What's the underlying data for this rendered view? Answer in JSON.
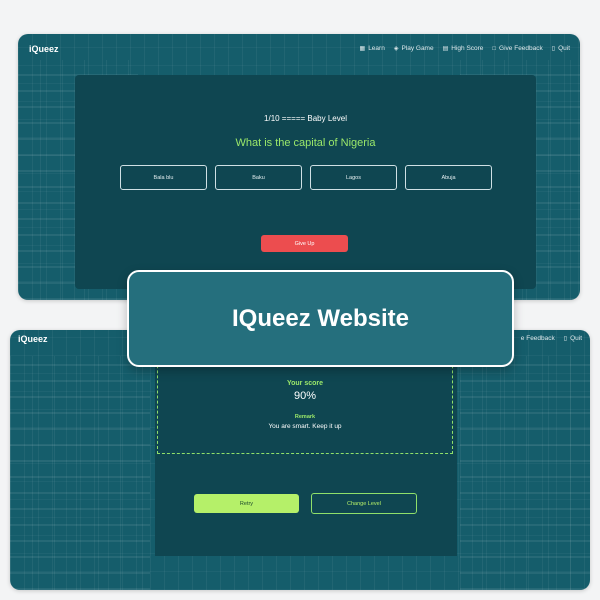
{
  "colors": {
    "page_bg": "#f3f4f5",
    "app_bg": "#155d6b",
    "panel_bg": "#0f4651",
    "accent_green": "#9be86a",
    "give_up_red": "#ec4d4f",
    "retry_green": "#b5f069",
    "card_bg": "#256f7d"
  },
  "top_screen": {
    "logo": "iQueez",
    "nav": [
      {
        "label": "Learn",
        "icon": "book-icon"
      },
      {
        "label": "Play Game",
        "icon": "gamepad-icon"
      },
      {
        "label": "High Score",
        "icon": "scoreboard-icon"
      },
      {
        "label": "Give Feedback",
        "icon": "chat-icon"
      },
      {
        "label": "Quit",
        "icon": "door-icon"
      }
    ],
    "quiz": {
      "level_text": "1/10 ===== Baby Level",
      "question": "What is the capital of Nigeria",
      "options": [
        "Bala blu",
        "Baku",
        "Lagos",
        "Abuja"
      ],
      "give_up_label": "Give Up"
    }
  },
  "bottom_screen": {
    "logo": "iQueez",
    "nav": [
      {
        "label": "e Feedback",
        "icon": "chat-icon"
      },
      {
        "label": "Quit",
        "icon": "door-icon"
      }
    ],
    "result": {
      "score_label": "Your score",
      "score_value": "90%",
      "remark_label": "Remark",
      "remark_text": "You are smart. Keep it up",
      "retry_label": "Retry",
      "change_level_label": "Change Level"
    }
  },
  "title_card": {
    "text": "IQueez Website"
  }
}
